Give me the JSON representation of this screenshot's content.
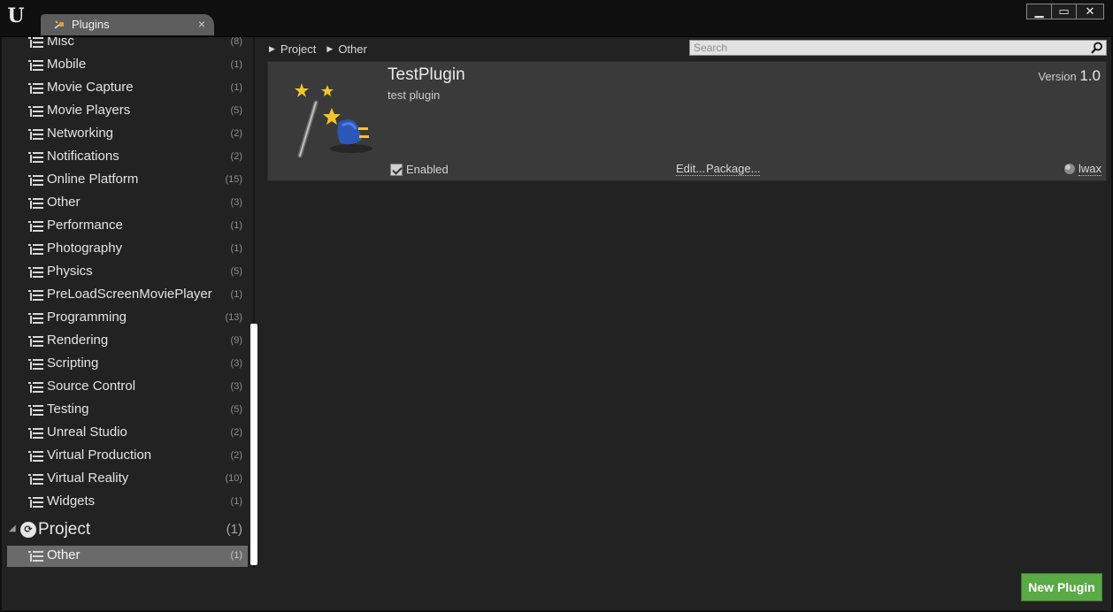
{
  "titlebar": {
    "logo_text": "U",
    "tab_label": "Plugins",
    "tab_close": "×",
    "minimize": "▁",
    "maximize": "▭",
    "close": "✕"
  },
  "sidebar": {
    "categories": [
      {
        "label": "Misc",
        "count": "(8)"
      },
      {
        "label": "Mobile",
        "count": "(1)"
      },
      {
        "label": "Movie Capture",
        "count": "(1)"
      },
      {
        "label": "Movie Players",
        "count": "(5)"
      },
      {
        "label": "Networking",
        "count": "(2)"
      },
      {
        "label": "Notifications",
        "count": "(2)"
      },
      {
        "label": "Online Platform",
        "count": "(15)"
      },
      {
        "label": "Other",
        "count": "(3)"
      },
      {
        "label": "Performance",
        "count": "(1)"
      },
      {
        "label": "Photography",
        "count": "(1)"
      },
      {
        "label": "Physics",
        "count": "(5)"
      },
      {
        "label": "PreLoadScreenMoviePlayer",
        "count": "(1)"
      },
      {
        "label": "Programming",
        "count": "(13)"
      },
      {
        "label": "Rendering",
        "count": "(9)"
      },
      {
        "label": "Scripting",
        "count": "(3)"
      },
      {
        "label": "Source Control",
        "count": "(3)"
      },
      {
        "label": "Testing",
        "count": "(5)"
      },
      {
        "label": "Unreal Studio",
        "count": "(2)"
      },
      {
        "label": "Virtual Production",
        "count": "(2)"
      },
      {
        "label": "Virtual Reality",
        "count": "(10)"
      },
      {
        "label": "Widgets",
        "count": "(1)"
      }
    ],
    "project": {
      "label": "Project",
      "count": "(1)"
    },
    "project_children": [
      {
        "label": "Other",
        "count": "(1)",
        "selected": true
      }
    ]
  },
  "breadcrumb": [
    "Project",
    "Other"
  ],
  "search": {
    "placeholder": "Search",
    "value": ""
  },
  "plugin": {
    "name": "TestPlugin",
    "description": "test plugin",
    "version_label": "Version",
    "version": "1.0",
    "enabled_label": "Enabled",
    "enabled": true,
    "edit_label": "Edit...",
    "package_label": "Package...",
    "author": "lwax"
  },
  "new_plugin_label": "New Plugin",
  "colors": {
    "accent_green": "#5aaa45",
    "selected_row": "#6a6a6a",
    "card_bg": "#3a3a3a"
  }
}
